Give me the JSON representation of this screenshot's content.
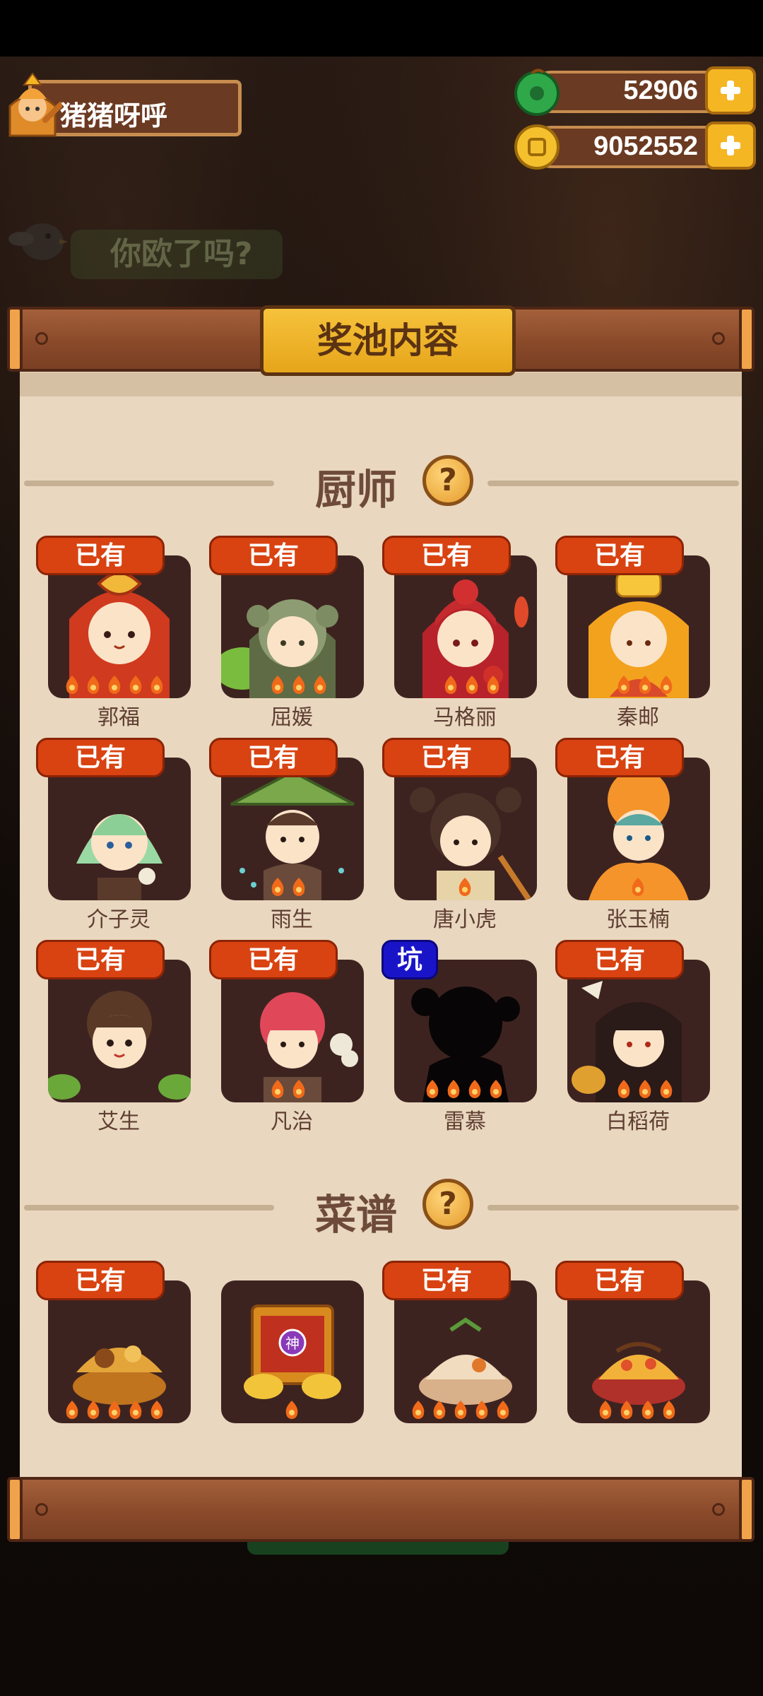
{
  "player": {
    "name": "猪猪呀呼"
  },
  "resources": {
    "jade": "52906",
    "coins": "9052552"
  },
  "background": {
    "hint": "你欧了吗?"
  },
  "modal": {
    "title": "奖池内容",
    "chef_section": {
      "title": "厨师",
      "help": "?",
      "items": [
        {
          "name": "郭福",
          "tag": "已有",
          "stars": 5
        },
        {
          "name": "屈媛",
          "tag": "已有",
          "stars": 3
        },
        {
          "name": "马格丽",
          "tag": "已有",
          "stars": 3
        },
        {
          "name": "秦邮",
          "tag": "已有",
          "stars": 3
        },
        {
          "name": "介子灵",
          "tag": "已有",
          "stars": 0
        },
        {
          "name": "雨生",
          "tag": "已有",
          "stars": 2
        },
        {
          "name": "唐小虎",
          "tag": "已有",
          "stars": 1
        },
        {
          "name": "张玉楠",
          "tag": "已有",
          "stars": 1
        },
        {
          "name": "艾生",
          "tag": "已有",
          "stars": 0
        },
        {
          "name": "凡治",
          "tag": "已有",
          "stars": 2
        },
        {
          "name": "雷慕",
          "tag": "坑",
          "stars": 4
        },
        {
          "name": "白稻荷",
          "tag": "已有",
          "stars": 3
        }
      ]
    },
    "recipe_section": {
      "title": "菜谱",
      "help": "?",
      "items": [
        {
          "tag": "已有",
          "stars": 5
        },
        {
          "tag": "",
          "stars": 1,
          "badge": "神"
        },
        {
          "tag": "已有",
          "stars": 5
        },
        {
          "tag": "已有",
          "stars": 4
        }
      ]
    }
  },
  "colors": {
    "owned_tag": "#d84311",
    "pit_tag": "#1a14c9",
    "card_bg": "#3d2320",
    "panel_bg": "#e9d7bf",
    "wood": "#8a4a2a",
    "title_plaque": "#f6c23c"
  }
}
